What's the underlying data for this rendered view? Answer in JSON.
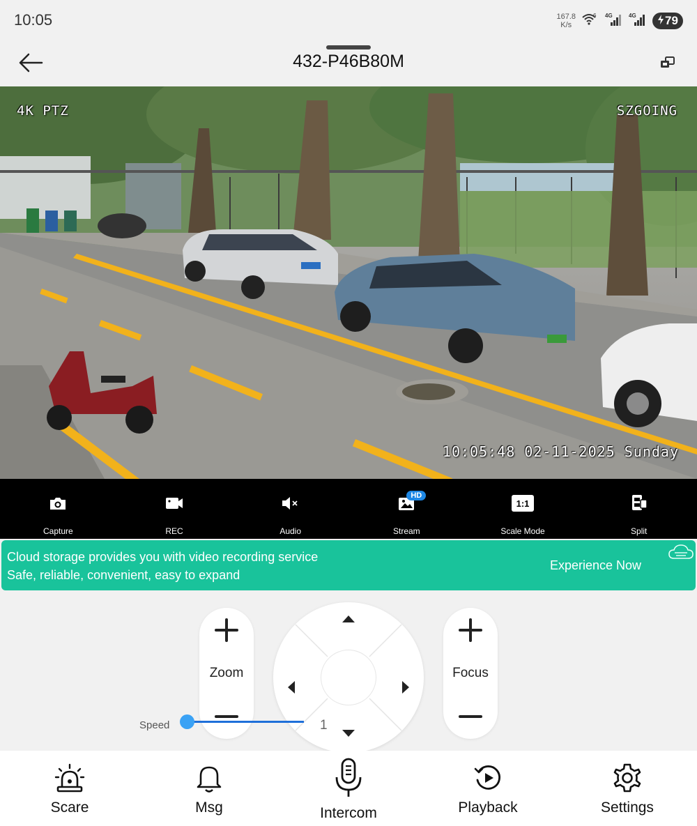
{
  "status_bar": {
    "time": "10:05",
    "net_speed_value": "167.8",
    "net_speed_unit": "K/s",
    "wifi_label": "6",
    "sim1_label": "4G",
    "sim2_label": "4G",
    "battery": "79"
  },
  "header": {
    "title": "432-P46B80M"
  },
  "video": {
    "osd_model": "4K PTZ",
    "osd_brand": "SZGOING",
    "osd_timestamp": "10:05:48 02-11-2025 Sunday"
  },
  "toolbar": {
    "items": [
      {
        "label": "Capture",
        "icon": "camera-icon"
      },
      {
        "label": "REC",
        "icon": "video-record-icon"
      },
      {
        "label": "Audio",
        "icon": "speaker-muted-icon"
      },
      {
        "label": "Stream",
        "icon": "image-icon",
        "badge": "HD"
      },
      {
        "label": "Scale Mode",
        "icon": "scale-icon",
        "icon_text": "1:1"
      },
      {
        "label": "Split",
        "icon": "split-screen-icon"
      }
    ]
  },
  "cloud_banner": {
    "line1": "Cloud storage provides you with video recording service",
    "line2": "Safe, reliable, convenient, easy to expand",
    "cta": "Experience Now",
    "color": "#19c39b"
  },
  "ptz": {
    "zoom_label": "Zoom",
    "focus_label": "Focus",
    "speed_label": "Speed",
    "speed_value": "1"
  },
  "bottom_nav": {
    "items": [
      {
        "label": "Scare",
        "icon": "siren-icon"
      },
      {
        "label": "Msg",
        "icon": "bell-icon"
      },
      {
        "label": "Intercom",
        "icon": "microphone-icon"
      },
      {
        "label": "Playback",
        "icon": "playback-icon"
      },
      {
        "label": "Settings",
        "icon": "gear-icon"
      }
    ]
  },
  "colors": {
    "accent_blue": "#1e88e5",
    "cloud_green": "#19c39b",
    "road_line_yellow": "#f2b21b"
  }
}
